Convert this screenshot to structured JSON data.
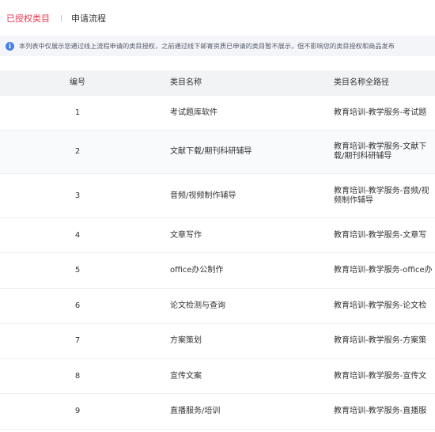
{
  "tabs": {
    "active": "已授权类目",
    "second": "申请流程"
  },
  "notice": {
    "text": "本列表中仅展示您通过线上流程申请的类目授权，之前通过线下邮寄资质已申请的类目暂不展示，但不影响您的类目授权和商品发布"
  },
  "table": {
    "headers": {
      "num": "编号",
      "name": "类目名称",
      "path": "类目名称全路径"
    },
    "rows": [
      {
        "num": "1",
        "name": "考试题库软件",
        "path": "教育培训-教学服务-考试题"
      },
      {
        "num": "2",
        "name": "文献下载/期刊科研辅导",
        "path": "教育培训-教学服务-文献下载/期刊科研辅导"
      },
      {
        "num": "3",
        "name": "音频/视频制作辅导",
        "path": "教育培训-教学服务-音频/视频制作辅导"
      },
      {
        "num": "4",
        "name": "文章写作",
        "path": "教育培训-教学服务-文章写"
      },
      {
        "num": "5",
        "name": "office办公制作",
        "path": "教育培训-教学服务-office办"
      },
      {
        "num": "6",
        "name": "论文检测与查询",
        "path": "教育培训-教学服务-论文检"
      },
      {
        "num": "7",
        "name": "方案策划",
        "path": "教育培训-教学服务-方案策"
      },
      {
        "num": "8",
        "name": "宣传文案",
        "path": "教育培训-教学服务-宣传文"
      },
      {
        "num": "9",
        "name": "直播服务/培训",
        "path": "教育培训-教学服务-直播服"
      }
    ]
  },
  "colors": {
    "accent": "#e8344e",
    "info": "#4a7fe0",
    "header_bg": "#f2f3f5",
    "notice_bg": "#f3f5f9"
  },
  "icons": {
    "notice": "info-circle-icon"
  }
}
